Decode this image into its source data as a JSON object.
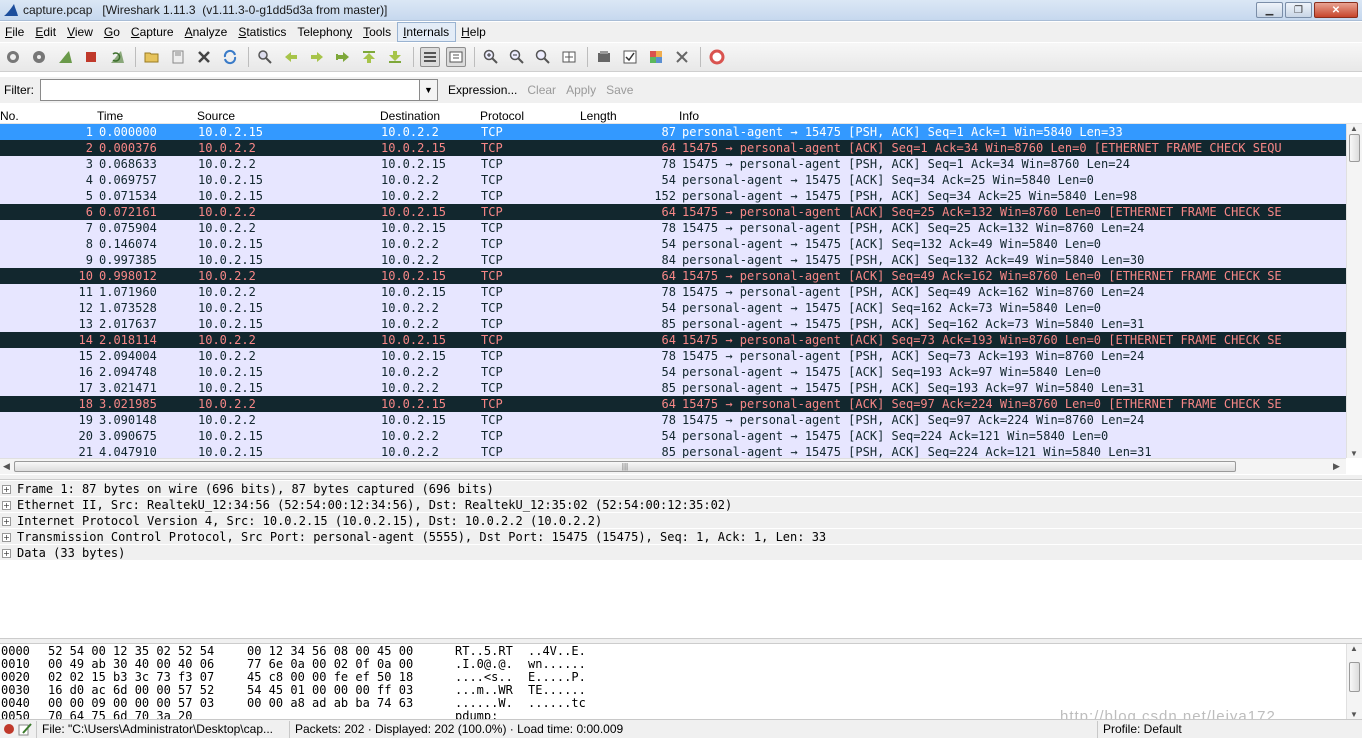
{
  "window": {
    "title": "capture.pcap   [Wireshark 1.11.3  (v1.11.3-0-g1dd5d3a from master)]",
    "app_icon": "wireshark-fin-icon",
    "buttons": {
      "minimize": "minimize-icon",
      "maximize": "restore-icon",
      "close": "close-icon"
    }
  },
  "menu": [
    "File",
    "Edit",
    "View",
    "Go",
    "Capture",
    "Analyze",
    "Statistics",
    "Telephony",
    "Tools",
    "Internals",
    "Help"
  ],
  "menu_underlines": [
    "F",
    "E",
    "V",
    "G",
    "C",
    "A",
    "S",
    "y",
    "T",
    "I",
    "H"
  ],
  "toolbar": {
    "icons": [
      "interfaces-icon",
      "options-icon",
      "start-capture-icon",
      "stop-capture-icon",
      "restart-capture-icon",
      "open-file-icon",
      "save-file-icon",
      "close-file-icon",
      "reload-icon",
      "find-packet-icon",
      "go-back-icon",
      "go-forward-icon",
      "go-to-packet-icon",
      "go-first-icon",
      "go-last-icon",
      "colorize-icon",
      "auto-scroll-icon",
      "zoom-in-icon",
      "zoom-out-icon",
      "normal-size-icon",
      "resize-columns-icon",
      "capture-filters-icon",
      "display-filters-icon",
      "coloring-rules-icon",
      "preferences-icon",
      "help-icon"
    ]
  },
  "filter": {
    "label": "Filter:",
    "value": "",
    "expression": "Expression...",
    "clear": "Clear",
    "apply": "Apply",
    "save": "Save"
  },
  "packet_list": {
    "columns": [
      "No.",
      "Time",
      "Source",
      "Destination",
      "Protocol",
      "Length",
      "Info"
    ],
    "rows": [
      {
        "no": "1",
        "time": "0.000000",
        "src": "10.0.2.15",
        "dst": "10.0.2.2",
        "proto": "TCP",
        "len": "87",
        "info": "personal-agent → 15475 [PSH, ACK] Seq=1 Ack=1 Win=5840 Len=33",
        "style": "sel"
      },
      {
        "no": "2",
        "time": "0.000376",
        "src": "10.0.2.2",
        "dst": "10.0.2.15",
        "proto": "TCP",
        "len": "64",
        "info": "15475 → personal-agent [ACK] Seq=1 Ack=34 Win=8760 Len=0 [ETHERNET FRAME CHECK SEQU",
        "style": "bad"
      },
      {
        "no": "3",
        "time": "0.068633",
        "src": "10.0.2.2",
        "dst": "10.0.2.15",
        "proto": "TCP",
        "len": "78",
        "info": "15475 → personal-agent [PSH, ACK] Seq=1 Ack=34 Win=8760 Len=24",
        "style": "tcp"
      },
      {
        "no": "4",
        "time": "0.069757",
        "src": "10.0.2.15",
        "dst": "10.0.2.2",
        "proto": "TCP",
        "len": "54",
        "info": "personal-agent → 15475 [ACK] Seq=34 Ack=25 Win=5840 Len=0",
        "style": "tcp"
      },
      {
        "no": "5",
        "time": "0.071534",
        "src": "10.0.2.15",
        "dst": "10.0.2.2",
        "proto": "TCP",
        "len": "152",
        "info": "personal-agent → 15475 [PSH, ACK] Seq=34 Ack=25 Win=5840 Len=98",
        "style": "tcp"
      },
      {
        "no": "6",
        "time": "0.072161",
        "src": "10.0.2.2",
        "dst": "10.0.2.15",
        "proto": "TCP",
        "len": "64",
        "info": "15475 → personal-agent [ACK] Seq=25 Ack=132 Win=8760 Len=0 [ETHERNET FRAME CHECK SE",
        "style": "bad"
      },
      {
        "no": "7",
        "time": "0.075904",
        "src": "10.0.2.2",
        "dst": "10.0.2.15",
        "proto": "TCP",
        "len": "78",
        "info": "15475 → personal-agent [PSH, ACK] Seq=25 Ack=132 Win=8760 Len=24",
        "style": "tcp"
      },
      {
        "no": "8",
        "time": "0.146074",
        "src": "10.0.2.15",
        "dst": "10.0.2.2",
        "proto": "TCP",
        "len": "54",
        "info": "personal-agent → 15475 [ACK] Seq=132 Ack=49 Win=5840 Len=0",
        "style": "tcp"
      },
      {
        "no": "9",
        "time": "0.997385",
        "src": "10.0.2.15",
        "dst": "10.0.2.2",
        "proto": "TCP",
        "len": "84",
        "info": "personal-agent → 15475 [PSH, ACK] Seq=132 Ack=49 Win=5840 Len=30",
        "style": "tcp"
      },
      {
        "no": "10",
        "time": "0.998012",
        "src": "10.0.2.2",
        "dst": "10.0.2.15",
        "proto": "TCP",
        "len": "64",
        "info": "15475 → personal-agent [ACK] Seq=49 Ack=162 Win=8760 Len=0 [ETHERNET FRAME CHECK SE",
        "style": "bad"
      },
      {
        "no": "11",
        "time": "1.071960",
        "src": "10.0.2.2",
        "dst": "10.0.2.15",
        "proto": "TCP",
        "len": "78",
        "info": "15475 → personal-agent [PSH, ACK] Seq=49 Ack=162 Win=8760 Len=24",
        "style": "tcp"
      },
      {
        "no": "12",
        "time": "1.073528",
        "src": "10.0.2.15",
        "dst": "10.0.2.2",
        "proto": "TCP",
        "len": "54",
        "info": "personal-agent → 15475 [ACK] Seq=162 Ack=73 Win=5840 Len=0",
        "style": "tcp"
      },
      {
        "no": "13",
        "time": "2.017637",
        "src": "10.0.2.15",
        "dst": "10.0.2.2",
        "proto": "TCP",
        "len": "85",
        "info": "personal-agent → 15475 [PSH, ACK] Seq=162 Ack=73 Win=5840 Len=31",
        "style": "tcp"
      },
      {
        "no": "14",
        "time": "2.018114",
        "src": "10.0.2.2",
        "dst": "10.0.2.15",
        "proto": "TCP",
        "len": "64",
        "info": "15475 → personal-agent [ACK] Seq=73 Ack=193 Win=8760 Len=0 [ETHERNET FRAME CHECK SE",
        "style": "bad"
      },
      {
        "no": "15",
        "time": "2.094004",
        "src": "10.0.2.2",
        "dst": "10.0.2.15",
        "proto": "TCP",
        "len": "78",
        "info": "15475 → personal-agent [PSH, ACK] Seq=73 Ack=193 Win=8760 Len=24",
        "style": "tcp"
      },
      {
        "no": "16",
        "time": "2.094748",
        "src": "10.0.2.15",
        "dst": "10.0.2.2",
        "proto": "TCP",
        "len": "54",
        "info": "personal-agent → 15475 [ACK] Seq=193 Ack=97 Win=5840 Len=0",
        "style": "tcp"
      },
      {
        "no": "17",
        "time": "3.021471",
        "src": "10.0.2.15",
        "dst": "10.0.2.2",
        "proto": "TCP",
        "len": "85",
        "info": "personal-agent → 15475 [PSH, ACK] Seq=193 Ack=97 Win=5840 Len=31",
        "style": "tcp"
      },
      {
        "no": "18",
        "time": "3.021985",
        "src": "10.0.2.2",
        "dst": "10.0.2.15",
        "proto": "TCP",
        "len": "64",
        "info": "15475 → personal-agent [ACK] Seq=97 Ack=224 Win=8760 Len=0 [ETHERNET FRAME CHECK SE",
        "style": "bad"
      },
      {
        "no": "19",
        "time": "3.090148",
        "src": "10.0.2.2",
        "dst": "10.0.2.15",
        "proto": "TCP",
        "len": "78",
        "info": "15475 → personal-agent [PSH, ACK] Seq=97 Ack=224 Win=8760 Len=24",
        "style": "tcp"
      },
      {
        "no": "20",
        "time": "3.090675",
        "src": "10.0.2.15",
        "dst": "10.0.2.2",
        "proto": "TCP",
        "len": "54",
        "info": "personal-agent → 15475 [ACK] Seq=224 Ack=121 Win=5840 Len=0",
        "style": "tcp"
      },
      {
        "no": "21",
        "time": "4.047910",
        "src": "10.0.2.15",
        "dst": "10.0.2.2",
        "proto": "TCP",
        "len": "85",
        "info": "personal-agent → 15475 [PSH, ACK] Seq=224 Ack=121 Win=5840 Len=31",
        "style": "tcp"
      }
    ],
    "colors": {
      "tcp_bg": "#e7e6ff",
      "tcp_fg": "#12272e",
      "bad_bg": "#12272e",
      "bad_fg": "#f78787",
      "selected_bg": "#3399ff"
    }
  },
  "details": [
    "Frame 1: 87 bytes on wire (696 bits), 87 bytes captured (696 bits)",
    "Ethernet II, Src: RealtekU_12:34:56 (52:54:00:12:34:56), Dst: RealtekU_12:35:02 (52:54:00:12:35:02)",
    "Internet Protocol Version 4, Src: 10.0.2.15 (10.0.2.15), Dst: 10.0.2.2 (10.0.2.2)",
    "Transmission Control Protocol, Src Port: personal-agent (5555), Dst Port: 15475 (15475), Seq: 1, Ack: 1, Len: 33",
    "Data (33 bytes)"
  ],
  "hex": [
    {
      "off": "0000",
      "b1": "52 54 00 12 35 02 52 54",
      "b2": "00 12 34 56 08 00 45 00",
      "a1": "RT..5.RT",
      "a2": "..4V..E."
    },
    {
      "off": "0010",
      "b1": "00 49 ab 30 40 00 40 06",
      "b2": "77 6e 0a 00 02 0f 0a 00",
      "a1": ".I.0@.@.",
      "a2": "wn......"
    },
    {
      "off": "0020",
      "b1": "02 02 15 b3 3c 73 f3 07",
      "b2": "45 c8 00 00 fe ef 50 18",
      "a1": "....<s..",
      "a2": "E.....P."
    },
    {
      "off": "0030",
      "b1": "16 d0 ac 6d 00 00 57 52",
      "b2": "54 45 01 00 00 00 ff 03",
      "a1": "...m..WR",
      "a2": "TE......"
    },
    {
      "off": "0040",
      "b1": "00 00 09 00 00 00 57 03",
      "b2": "00 00 a8 ad ab ba 74 63",
      "a1": "......W.",
      "a2": "......tc"
    },
    {
      "off": "0050",
      "b1": "70 64 75 6d 70 3a 20",
      "b2": "",
      "a1": "pdump:",
      "a2": ""
    }
  ],
  "status": {
    "file": "File: \"C:\\Users\\Administrator\\Desktop\\cap...",
    "packets": "Packets: 202 · Displayed: 202 (100.0%) · Load time: 0:00.009",
    "profile": "Profile: Default",
    "icons": [
      "capture-status-icon",
      "edit-comment-icon"
    ]
  },
  "watermark": "http://blog.csdn.net/leiya172"
}
